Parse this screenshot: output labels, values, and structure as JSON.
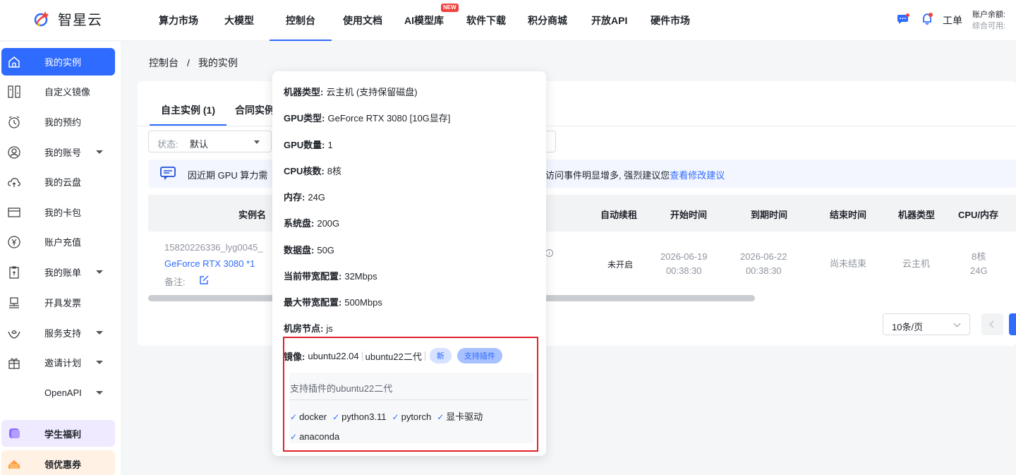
{
  "brand": {
    "name": "智星云"
  },
  "nav": {
    "items": [
      "算力市场",
      "大模型",
      "控制台",
      "使用文档",
      "AI模型库",
      "软件下载",
      "积分商城",
      "开放API",
      "硬件市场"
    ],
    "new_badge": "NEW",
    "ticket": "工单",
    "balance_label": "账户余额: ",
    "available_label": "综合可用: "
  },
  "sidebar": {
    "items": [
      {
        "label": "我的实例",
        "icon": "home-icon"
      },
      {
        "label": "自定义镜像",
        "icon": "image-icon"
      },
      {
        "label": "我的预约",
        "icon": "alarm-clock-icon"
      },
      {
        "label": "我的账号",
        "icon": "user-icon"
      },
      {
        "label": "我的云盘",
        "icon": "cloud-icon"
      },
      {
        "label": "我的卡包",
        "icon": "card-icon"
      },
      {
        "label": "账户充值",
        "icon": "yen-circle-icon"
      },
      {
        "label": "我的账单",
        "icon": "bill-icon"
      },
      {
        "label": "开具发票",
        "icon": "invoice-icon"
      },
      {
        "label": "服务支持",
        "icon": "support-icon"
      },
      {
        "label": "邀请计划",
        "icon": "gift-icon"
      },
      {
        "label": "OpenAPI",
        "icon": ""
      }
    ],
    "promo1": "学生福利",
    "promo2": "领优惠券"
  },
  "breadcrumb": {
    "root": "控制台",
    "sep": "/",
    "current": "我的实例"
  },
  "tabs": {
    "own": "自主实例 (1)",
    "contract": "合同实例"
  },
  "filter": {
    "label": "状态:",
    "value": "默认"
  },
  "notice": {
    "text_start": "因近期 GPU 算力需",
    "text_end": "访问事件明显增多, 强烈建议您",
    "link": "查看修改建议"
  },
  "table": {
    "headers": {
      "name": "实例名",
      "auto_renew": "自动续租",
      "start": "开始时间",
      "expire": "到期时间",
      "end": "结束时间",
      "machine": "机器类型",
      "cpu_mem": "CPU/内存"
    },
    "row": {
      "id": "15820226336_lyg0045_",
      "gpu": "GeForce RTX 3080 *1",
      "note": "备注:",
      "auto_renew": "未开启",
      "start_date": "2026-06-19",
      "start_time": "00:38:30",
      "expire_date": "2026-06-22",
      "expire_time": "00:38:30",
      "end": "尚未结束",
      "machine": "云主机",
      "cpu": "8核",
      "mem": "24G"
    }
  },
  "pager": {
    "size": "10条/页"
  },
  "popover": {
    "lines": [
      {
        "k": "机器类型:",
        "v": "云主机 (支持保留磁盘)"
      },
      {
        "k": "GPU类型:",
        "v": "GeForce RTX 3080 [10G显存]"
      },
      {
        "k": "GPU数量:",
        "v": "1"
      },
      {
        "k": "CPU核数:",
        "v": "8核"
      },
      {
        "k": "内存:",
        "v": "24G"
      },
      {
        "k": "系统盘:",
        "v": "200G"
      },
      {
        "k": "数据盘:",
        "v": "50G"
      },
      {
        "k": "当前带宽配置:",
        "v": "32Mbps"
      },
      {
        "k": "最大带宽配置:",
        "v": "500Mbps"
      },
      {
        "k": "机房节点:",
        "v": "js"
      }
    ],
    "mirror_label": "镜像:",
    "mirror_os": "ubuntu22.04",
    "mirror_name": "ubuntu22二代",
    "tag_new": "新",
    "tag_plugin": "支持插件",
    "plugin_title": "支持插件的ubuntu22二代",
    "plugins": [
      "docker",
      "python3.11",
      "pytorch",
      "显卡驱动",
      "anaconda"
    ]
  },
  "colors": {
    "accent": "#2f6bff",
    "highlight_box": "#e0212b",
    "badge_red": "#f0433c"
  }
}
